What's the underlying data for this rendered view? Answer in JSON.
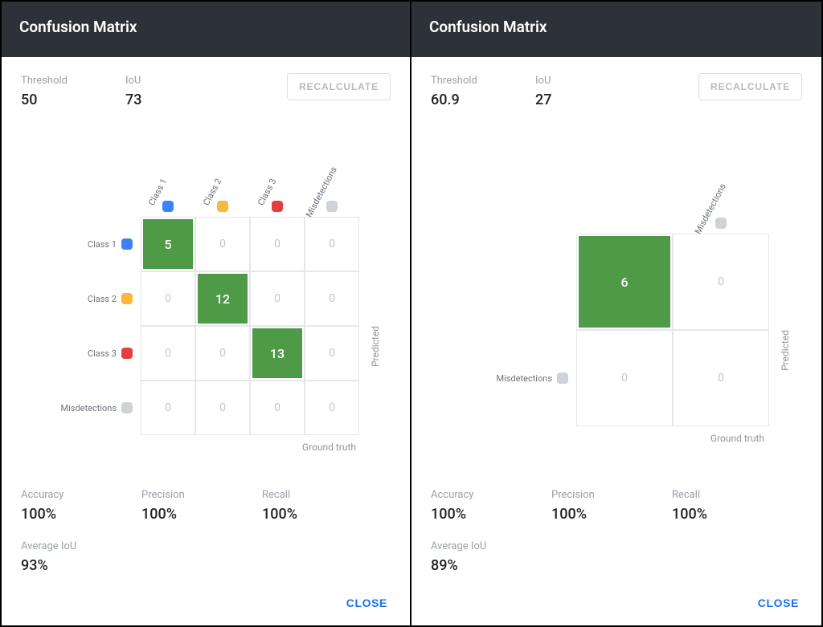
{
  "panels": [
    {
      "header_title": "Confusion Matrix",
      "threshold_label": "Threshold",
      "threshold_value": "50",
      "iou_label": "IoU",
      "iou_value": "73",
      "recalculate_label": "RECALCULATE",
      "classes": [
        {
          "name": "Class 1",
          "color": "#3b82f6"
        },
        {
          "name": "Class 2",
          "color": "#f9b83a"
        },
        {
          "name": "Class 3",
          "color": "#e63d3d"
        },
        {
          "name": "Misdetections",
          "color": "#cfd2d6"
        }
      ],
      "matrix": [
        [
          {
            "v": "5",
            "hl": true
          },
          {
            "v": "0"
          },
          {
            "v": "0"
          },
          {
            "v": "0"
          }
        ],
        [
          {
            "v": "0"
          },
          {
            "v": "12",
            "hl": true
          },
          {
            "v": "0"
          },
          {
            "v": "0"
          }
        ],
        [
          {
            "v": "0"
          },
          {
            "v": "0"
          },
          {
            "v": "13",
            "hl": true
          },
          {
            "v": "0"
          }
        ],
        [
          {
            "v": "0"
          },
          {
            "v": "0"
          },
          {
            "v": "0"
          },
          {
            "v": "0"
          }
        ]
      ],
      "ground_truth_label": "Ground truth",
      "predicted_label": "Predicted",
      "accuracy_label": "Accuracy",
      "accuracy_value": "100%",
      "precision_label": "Precision",
      "precision_value": "100%",
      "recall_label": "Recall",
      "recall_value": "100%",
      "avg_iou_label": "Average IoU",
      "avg_iou_value": "93%",
      "close_label": "CLOSE"
    },
    {
      "header_title": "Confusion Matrix",
      "threshold_label": "Threshold",
      "threshold_value": "60.9",
      "iou_label": "IoU",
      "iou_value": "27",
      "recalculate_label": "RECALCULATE",
      "classes": [
        {
          "name": "",
          "color": ""
        },
        {
          "name": "Misdetections",
          "color": "#cfd2d6"
        }
      ],
      "row_labels": [
        {
          "name": "",
          "color": ""
        },
        {
          "name": "Misdetections",
          "color": "#cfd2d6"
        }
      ],
      "matrix": [
        [
          {
            "v": "6",
            "hl": true
          },
          {
            "v": "0"
          }
        ],
        [
          {
            "v": "0"
          },
          {
            "v": "0"
          }
        ]
      ],
      "ground_truth_label": "Ground truth",
      "predicted_label": "Predicted",
      "accuracy_label": "Accuracy",
      "accuracy_value": "100%",
      "precision_label": "Precision",
      "precision_value": "100%",
      "recall_label": "Recall",
      "recall_value": "100%",
      "avg_iou_label": "Average IoU",
      "avg_iou_value": "89%",
      "close_label": "CLOSE"
    }
  ],
  "chart_data": [
    {
      "type": "heatmap",
      "title": "Confusion Matrix",
      "xlabel": "Ground truth",
      "ylabel": "Predicted",
      "categories_x": [
        "Class 1",
        "Class 2",
        "Class 3",
        "Misdetections"
      ],
      "categories_y": [
        "Class 1",
        "Class 2",
        "Class 3",
        "Misdetections"
      ],
      "values": [
        [
          5,
          0,
          0,
          0
        ],
        [
          0,
          12,
          0,
          0
        ],
        [
          0,
          0,
          13,
          0
        ],
        [
          0,
          0,
          0,
          0
        ]
      ],
      "threshold": 50,
      "iou": 73,
      "metrics": {
        "accuracy": 1.0,
        "precision": 1.0,
        "recall": 1.0,
        "average_iou": 0.93
      }
    },
    {
      "type": "heatmap",
      "title": "Confusion Matrix",
      "xlabel": "Ground truth",
      "ylabel": "Predicted",
      "categories_x": [
        "",
        "Misdetections"
      ],
      "categories_y": [
        "",
        "Misdetections"
      ],
      "values": [
        [
          6,
          0
        ],
        [
          0,
          0
        ]
      ],
      "threshold": 60.9,
      "iou": 27,
      "metrics": {
        "accuracy": 1.0,
        "precision": 1.0,
        "recall": 1.0,
        "average_iou": 0.89
      }
    }
  ]
}
